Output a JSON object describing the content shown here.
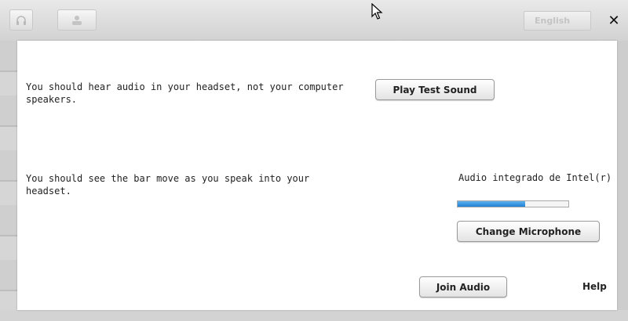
{
  "header": {
    "language_label": "English",
    "close_label": "✕",
    "icons": [
      "headset-icon",
      "presenter-icon",
      "cursor-icon"
    ]
  },
  "dialog": {
    "speaker_message": "You should hear audio in your headset, not your computer speakers.",
    "play_test_sound_label": "Play Test Sound",
    "mic_message": "You should see the bar move as you speak into your headset.",
    "device_name": "Audio integrado de Intel(r)",
    "mic_level_fraction": 0.61,
    "change_microphone_label": "Change Microphone",
    "join_audio_label": "Join Audio",
    "help_label": "Help"
  },
  "colors": {
    "meter_fill": "#2a88d8",
    "dialog_bg": "#ffffff",
    "backdrop": "#d9d9d9"
  }
}
